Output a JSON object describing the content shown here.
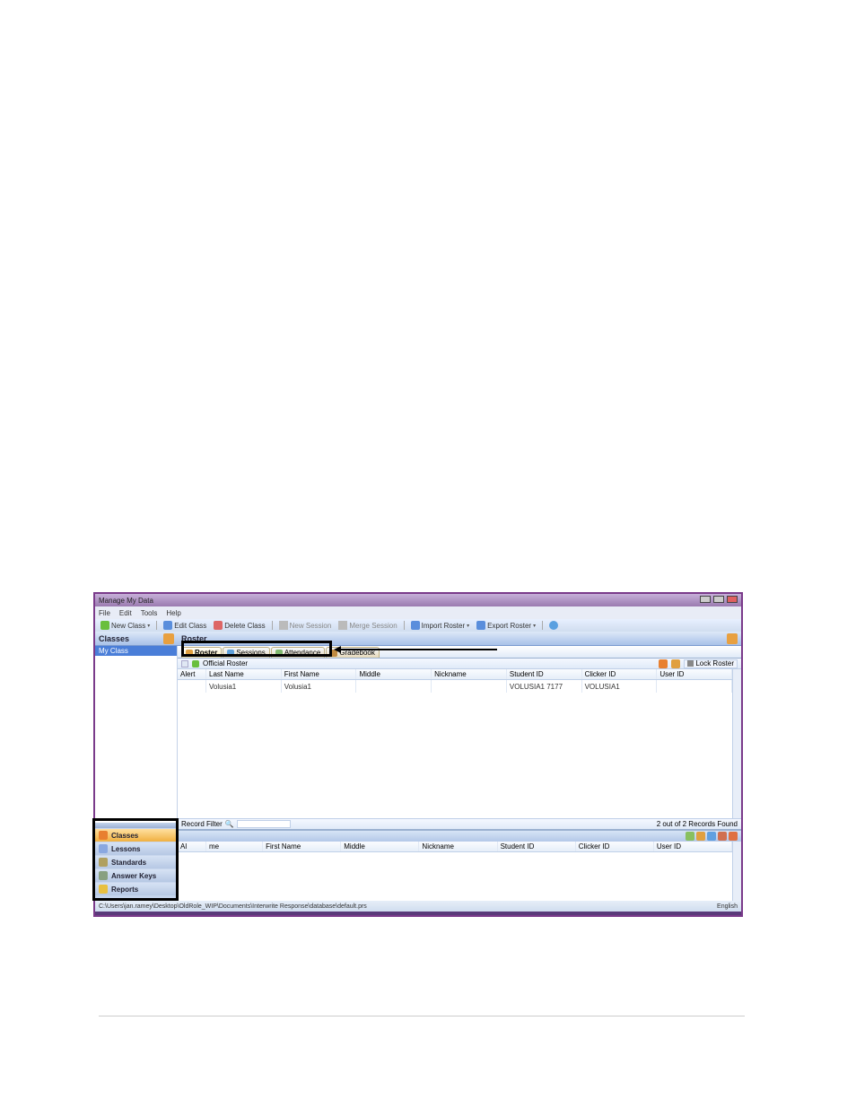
{
  "window_title": "Manage My Data",
  "menus": [
    "File",
    "Edit",
    "Tools",
    "Help"
  ],
  "toolbar": {
    "new_class": "New Class",
    "edit_class": "Edit Class",
    "delete_class": "Delete Class",
    "new_session": "New Session",
    "merge_session": "Merge Session",
    "import_roster": "Import Roster",
    "export_roster": "Export Roster"
  },
  "left_panel_title": "Classes",
  "class_item": "My Class",
  "nav_items": {
    "classes": "Classes",
    "lessons": "Lessons",
    "standards": "Standards",
    "answer_keys": "Answer Keys",
    "reports": "Reports"
  },
  "right_panel_title": "Roster",
  "tabs": {
    "roster": "Roster",
    "sessions": "Sessions",
    "attendance": "Attendance",
    "gradebook": "Gradebook"
  },
  "roster_bar": {
    "label": "Official Roster",
    "lock": "Lock Roster"
  },
  "columns": {
    "alert": "Alert",
    "last_name": "Last Name",
    "first_name": "First Name",
    "middle": "Middle",
    "nickname": "Nickname",
    "student_id": "Student ID",
    "clicker_id": "Clicker ID",
    "user_id": "User ID"
  },
  "rows": [
    {
      "alert": "",
      "last_name": "Volusia1",
      "first_name": "Volusia1",
      "middle": "",
      "nickname": "",
      "student_id": "VOLUSIA1 7177",
      "clicker_id": "VOLUSIA1",
      "user_id": ""
    }
  ],
  "record_filter": {
    "label": "Record Filter",
    "placeholder": "",
    "status": "2 out of 2 Records Found"
  },
  "lower_columns": {
    "alert": "Al",
    "suffix": "me",
    "first_name": "First Name",
    "middle": "Middle",
    "nickname": "Nickname",
    "student_id": "Student ID",
    "clicker_id": "Clicker ID",
    "user_id": "User ID"
  },
  "status_path": "C:\\Users\\jan.ramey\\Desktop\\OldRole_WIP\\Documents\\Interwrite Response\\database\\default.prs",
  "status_lang": "English"
}
